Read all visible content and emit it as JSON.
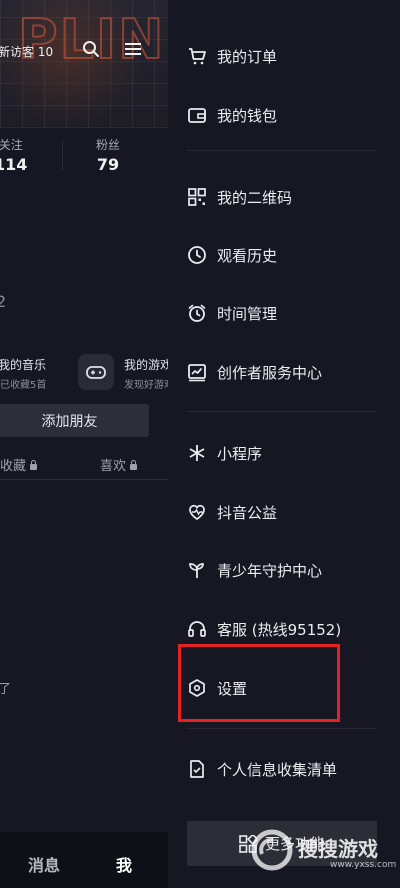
{
  "profile": {
    "visitor_text": "新访客 10",
    "stats": {
      "following_label": "关注",
      "following_value": "114",
      "fans_label": "粉丝",
      "fans_value": "79"
    },
    "partial_number": "2",
    "music_title": "我的音乐",
    "music_sub": "已收藏5首",
    "game_title": "我的游戏",
    "game_sub": "发现好游戏",
    "add_friend": "添加朋友",
    "tab_favorites": "收藏",
    "tab_likes": "喜欢",
    "partial_text": "了"
  },
  "bottom_nav": {
    "messages": "消息",
    "me": "我"
  },
  "drawer": {
    "items": [
      {
        "label": "我的订单",
        "icon": "cart-icon"
      },
      {
        "label": "我的钱包",
        "icon": "wallet-icon"
      },
      {
        "label": "我的二维码",
        "icon": "qrcode-icon"
      },
      {
        "label": "观看历史",
        "icon": "clock-icon"
      },
      {
        "label": "时间管理",
        "icon": "alarm-icon"
      },
      {
        "label": "创作者服务中心",
        "icon": "chart-icon"
      },
      {
        "label": "小程序",
        "icon": "asterisk-icon"
      },
      {
        "label": "抖音公益",
        "icon": "heart-pulse-icon"
      },
      {
        "label": "青少年守护中心",
        "icon": "sprout-icon"
      },
      {
        "label": "客服 (热线95152)",
        "icon": "headset-icon"
      },
      {
        "label": "设置",
        "icon": "settings-hexagon-icon"
      },
      {
        "label": "个人信息收集清单",
        "icon": "document-icon"
      }
    ],
    "more_label": "更多功能"
  },
  "watermark": {
    "text": "搜搜游戏",
    "sub": "www.yxss.com"
  },
  "colors": {
    "background": "#15161f",
    "highlight": "#e52222",
    "button_bg": "#2d2e38"
  }
}
